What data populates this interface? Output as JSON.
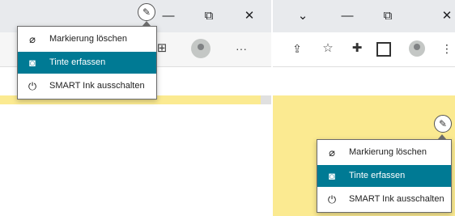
{
  "colors": {
    "menu_active": "#007a94",
    "page_yellow": "#fbea91",
    "titlebar": "#e8eaed"
  },
  "left": {
    "window_controls": {
      "minimize": "—",
      "restore": "⧉",
      "close": "✕"
    },
    "toolbar": {
      "more_icon": "···"
    },
    "menu": {
      "items": [
        {
          "label": "Markierung löschen",
          "icon": "eraser-icon"
        },
        {
          "label": "Tinte erfassen",
          "icon": "camera-icon",
          "active": true
        },
        {
          "label": "SMART Ink ausschalten",
          "icon": "power-icon"
        }
      ]
    }
  },
  "right": {
    "window_controls": {
      "dropdown": "⌄",
      "minimize": "—",
      "restore": "⧉",
      "close": "✕"
    },
    "toolbar_icons": [
      "share-icon",
      "star-icon",
      "extensions-icon",
      "sidepanel-icon",
      "profile-icon",
      "menu-icon"
    ],
    "menu": {
      "items": [
        {
          "label": "Markierung löschen",
          "icon": "eraser-icon"
        },
        {
          "label": "Tinte erfassen",
          "icon": "camera-icon",
          "active": true
        },
        {
          "label": "SMART Ink ausschalten",
          "icon": "power-icon"
        }
      ]
    }
  }
}
